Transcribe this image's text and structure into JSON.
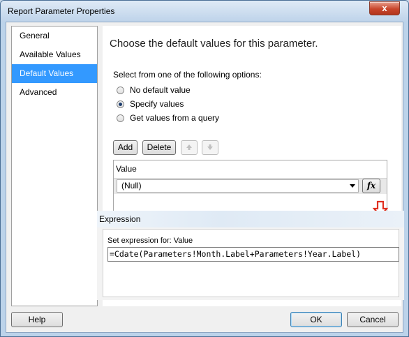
{
  "window": {
    "title": "Report Parameter Properties",
    "close_label": "x"
  },
  "nav": {
    "items": [
      {
        "label": "General",
        "active": false
      },
      {
        "label": "Available Values",
        "active": false
      },
      {
        "label": "Default Values",
        "active": true
      },
      {
        "label": "Advanced",
        "active": false
      }
    ]
  },
  "main": {
    "heading": "Choose the default values for this parameter.",
    "options_label": "Select from one of the following options:",
    "options": [
      {
        "label": "No default value",
        "checked": false
      },
      {
        "label": "Specify values",
        "checked": true
      },
      {
        "label": "Get values from a query",
        "checked": false
      }
    ],
    "add_label": "Add",
    "delete_label": "Delete",
    "grid": {
      "header": "Value",
      "row_value": "(Null)",
      "fx_label": "fx"
    }
  },
  "expression": {
    "title": "Expression",
    "set_label": "Set expression for: Value",
    "value": "=Cdate(Parameters!Month.Label+Parameters!Year.Label)"
  },
  "footer": {
    "help_label": "Help",
    "ok_label": "OK",
    "cancel_label": "Cancel"
  },
  "colors": {
    "selection": "#3399ff",
    "annotation_arrow": "#e03020"
  }
}
